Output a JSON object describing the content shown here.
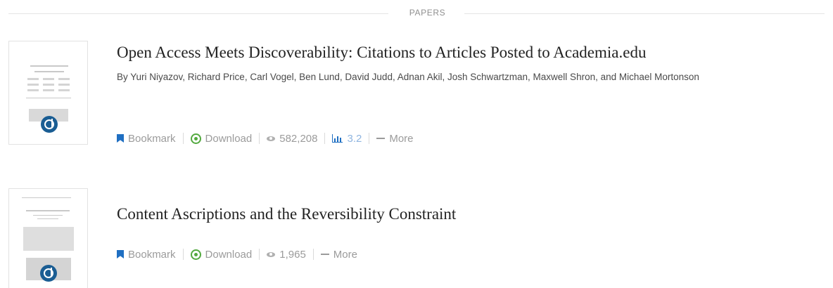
{
  "section": {
    "label": "PAPERS"
  },
  "papers": [
    {
      "title": "Open Access Meets Discoverability: Citations to Articles Posted to Academia.edu",
      "authors": "By Yuri Niyazov, Richard Price, Carl Vogel, Ben Lund, David Judd, Adnan Akil, Josh Schwartzman, Maxwell Shron, and Michael Mortonson",
      "actions": {
        "bookmark": "Bookmark",
        "download": "Download",
        "views": "582,208",
        "impact": "3.2",
        "more": "More"
      }
    },
    {
      "title": "Content Ascriptions and the Reversibility Constraint",
      "actions": {
        "bookmark": "Bookmark",
        "download": "Download",
        "views": "1,965",
        "more": "More"
      }
    }
  ],
  "colors": {
    "bookmark": "#1f6fc2",
    "download": "#53a93f",
    "logo": "#1a5d93"
  },
  "icons": [
    "bookmark-icon",
    "download-icon",
    "eye-icon",
    "bar-chart-icon",
    "more-icon",
    "academia-logo-icon"
  ]
}
